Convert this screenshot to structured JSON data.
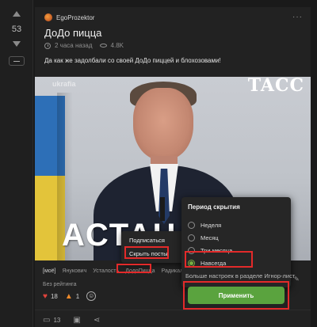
{
  "vote": {
    "score": "53"
  },
  "post": {
    "author": "EgoProzektor",
    "title": "ДоДо пицца",
    "time": "2 часа назад",
    "views": "4.8K",
    "text": "Да как же задолбали со своей ДоДо пиццей и блохозовами!",
    "media": {
      "watermark_left": "ukrafia",
      "watermark_right": "TACC",
      "caption": "АСТАНА... Р"
    },
    "tags": [
      "[моё]",
      "Янукович",
      "Усталость",
      "ДодоПицца",
      "Радикальн..."
    ],
    "rating_note": "Без рейтинга",
    "reactions": [
      {
        "icon": "heart-icon",
        "count": "18"
      },
      {
        "icon": "fire-icon",
        "count": "1"
      }
    ],
    "comments_count": "13"
  },
  "context_menu": {
    "items": [
      "Подписаться",
      "Скрыть посты"
    ]
  },
  "hide_dropdown": {
    "title": "Период скрытия",
    "options": [
      "Неделя",
      "Месяц",
      "Три месяца",
      "Навсегда"
    ],
    "selected": "Навсегда",
    "under_text": "Больше настроек в разделе Игнор-лист",
    "apply_label": "Применить"
  },
  "colors": {
    "accent": "#5aa33e",
    "highlight": "#e32a2a",
    "background": "#1a1a1a"
  }
}
